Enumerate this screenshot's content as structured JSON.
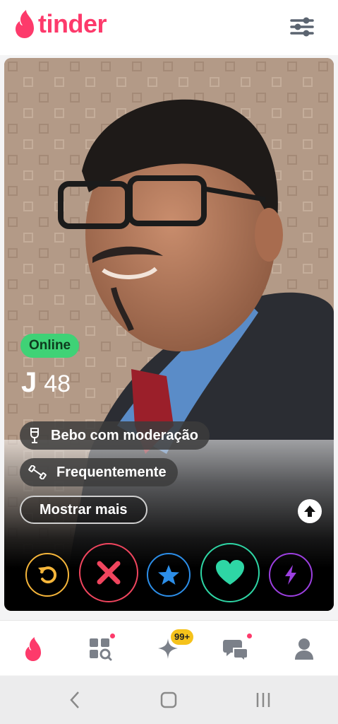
{
  "header": {
    "app_name": "tinder",
    "brand_color": "#fd3a6b",
    "settings_icon": "sliders-icon"
  },
  "profile": {
    "status": "Online",
    "name": "J",
    "age": "48",
    "tags": [
      {
        "icon": "glass-icon",
        "label": "Bebo com moderação"
      },
      {
        "icon": "dumbbell-icon",
        "label": "Frequentemente"
      }
    ],
    "show_more": "Mostrar mais"
  },
  "actions": [
    {
      "name": "rewind",
      "color": "#f5b53a",
      "icon": "rewind-icon"
    },
    {
      "name": "nope",
      "color": "#f0455e",
      "icon": "x-icon"
    },
    {
      "name": "super-like",
      "color": "#2c8ee8",
      "icon": "star-icon"
    },
    {
      "name": "like",
      "color": "#2ed6a5",
      "icon": "heart-icon"
    },
    {
      "name": "boost",
      "color": "#9c3fe0",
      "icon": "lightning-icon"
    }
  ],
  "bottom_nav": {
    "items": [
      "home",
      "explore",
      "likes",
      "messages",
      "profile"
    ],
    "likes_badge": "99+"
  }
}
